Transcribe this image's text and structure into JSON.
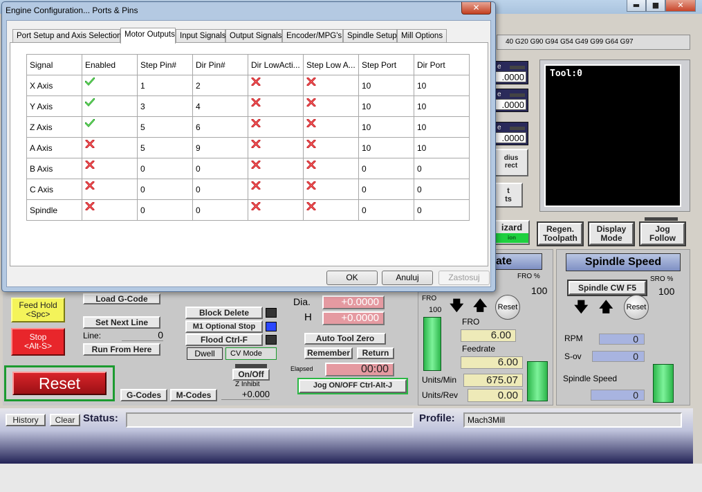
{
  "dialog": {
    "title": "Engine Configuration... Ports & Pins",
    "close_glyph": "✕",
    "tabs": [
      "Port Setup and Axis Selection",
      "Motor Outputs",
      "Input Signals",
      "Output Signals",
      "Encoder/MPG's",
      "Spindle Setup",
      "Mill Options"
    ],
    "active_tab": "Motor Outputs",
    "columns": [
      "Signal",
      "Enabled",
      "Step Pin#",
      "Dir Pin#",
      "Dir LowActi...",
      "Step Low A...",
      "Step Port",
      "Dir Port"
    ],
    "rows": [
      {
        "signal": "X Axis",
        "enabled": true,
        "step_pin": "1",
        "dir_pin": "2",
        "dir_low": false,
        "step_low": false,
        "step_port": "10",
        "dir_port": "10"
      },
      {
        "signal": "Y Axis",
        "enabled": true,
        "step_pin": "3",
        "dir_pin": "4",
        "dir_low": false,
        "step_low": false,
        "step_port": "10",
        "dir_port": "10"
      },
      {
        "signal": "Z Axis",
        "enabled": true,
        "step_pin": "5",
        "dir_pin": "6",
        "dir_low": false,
        "step_low": false,
        "step_port": "10",
        "dir_port": "10"
      },
      {
        "signal": "A Axis",
        "enabled": false,
        "step_pin": "5",
        "dir_pin": "9",
        "dir_low": false,
        "step_low": false,
        "step_port": "10",
        "dir_port": "10"
      },
      {
        "signal": "B Axis",
        "enabled": false,
        "step_pin": "0",
        "dir_pin": "0",
        "dir_low": false,
        "step_low": false,
        "step_port": "0",
        "dir_port": "0"
      },
      {
        "signal": "C Axis",
        "enabled": false,
        "step_pin": "0",
        "dir_pin": "0",
        "dir_low": false,
        "step_low": false,
        "step_port": "0",
        "dir_port": "0"
      },
      {
        "signal": "Spindle",
        "enabled": false,
        "step_pin": "0",
        "dir_pin": "0",
        "dir_low": false,
        "step_low": false,
        "step_port": "0",
        "dir_port": "0"
      }
    ],
    "buttons": {
      "ok": "OK",
      "cancel": "Anuluj",
      "apply": "Zastosuj"
    },
    "icons": {
      "enabled": "green-check-icon",
      "disabled": "red-cross-icon"
    }
  },
  "mach": {
    "window_buttons": {
      "minimize": "▬",
      "maximize": "■",
      "close": "✕"
    },
    "gcodes_line": "40 G20 G90 G94 G54 G49 G99 G64 G97",
    "dro_values": [
      ".0000",
      ".0000",
      ".0000"
    ],
    "dro_label": "e",
    "radius_correct": "dius\nrect",
    "offsets_btn": "t\nts",
    "tool_label": "Tool:0",
    "toolpath_buttons": {
      "regen": "Regen.\nToolpath",
      "display": "Display\nMode",
      "jog_follow": "Jog\nFollow"
    },
    "wizard_btn": "izard",
    "wizard_sub": "ion",
    "feed_strip": "ate",
    "fro_pct_label": "FRO %",
    "fro_pct_value": "100",
    "spindle_speed_title": "Spindle Speed",
    "spindle_cw_btn": "Spindle CW F5",
    "sro_label": "SRO %",
    "sro_value": "100",
    "reset_small": "Reset",
    "fro_left_label": "FRO",
    "fro_left_value": "100",
    "fro_label": "FRO",
    "fro_value": "6.00",
    "feedrate_label": "Feedrate",
    "feedrate_value": "6.00",
    "units_min_label": "Units/Min",
    "units_min_value": "675.07",
    "units_rev_label": "Units/Rev",
    "units_rev_value": "0.00",
    "rpm_label": "RPM",
    "rpm_value": "0",
    "sov_label": "S-ov",
    "sov_value": "0",
    "spindle_speed_label": "Spindle Speed",
    "spindle_speed_value": "0",
    "feed_hold": "Feed Hold\n<Spc>",
    "stop": "Stop\n<Alt-S>",
    "load_gcode": "Load G-Code",
    "set_next_line": "Set Next Line",
    "line_label": "Line:",
    "line_value": "0",
    "run_from_here": "Run From Here",
    "block_delete": "Block Delete",
    "m1_optional_stop": "M1 Optional Stop",
    "flood": "Flood Ctrl-F",
    "dwell": "Dwell",
    "cv_mode": "CV Mode",
    "dia_label": "Dia.",
    "dia_value": "+0.0000",
    "h_label": "H",
    "h_value": "+0.0000",
    "auto_tool_zero": "Auto Tool Zero",
    "remember": "Remember",
    "return": "Return",
    "elapsed_label": "Elapsed",
    "elapsed_value": "00:00",
    "jog_onoff": "Jog ON/OFF Ctrl-Alt-J",
    "reset": "Reset",
    "onoff": "On/Off",
    "z_inhibit_label": "Z Inhibit",
    "z_inhibit_value": "+0.000",
    "gcodes_btn": "G-Codes",
    "mcodes_btn": "M-Codes",
    "history_btn": "History",
    "clear_btn": "Clear",
    "status_label": "Status:",
    "status_value": "",
    "profile_label": "Profile:",
    "profile_value": "Mach3Mill"
  }
}
